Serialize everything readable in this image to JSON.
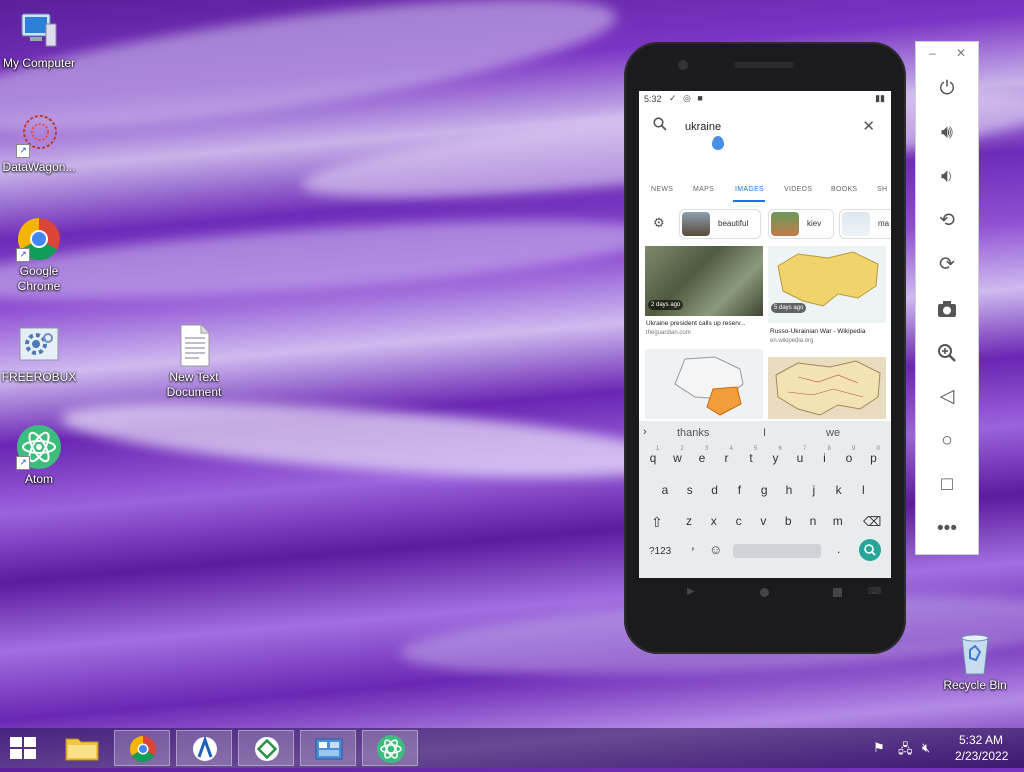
{
  "desktop": {
    "icons": [
      {
        "label": "My Computer"
      },
      {
        "label": "DataWagon..."
      },
      {
        "label": "Google Chrome"
      },
      {
        "label": "FREEROBUX"
      },
      {
        "label": "New Text Document"
      },
      {
        "label": "Atom"
      },
      {
        "label": "Recycle Bin"
      }
    ]
  },
  "phone": {
    "status": {
      "time": "5:32"
    },
    "search": {
      "query": "ukraine"
    },
    "tabs": [
      "NEWS",
      "MAPS",
      "IMAGES",
      "VIDEOS",
      "BOOKS",
      "SH"
    ],
    "active_tab": "IMAGES",
    "chips": [
      "beautiful",
      "kiev",
      "ma"
    ],
    "results": [
      {
        "badge": "2 days ago",
        "title": "Ukraine president calls up reserv...",
        "source": "theguardian.com"
      },
      {
        "badge": "5 days ago",
        "title": "Russo-Ukrainian War - Wikipedia",
        "source": "en.wikipedia.org"
      }
    ],
    "keyboard": {
      "suggestions": [
        "thanks",
        "I",
        "we"
      ],
      "row1": [
        "q",
        "w",
        "e",
        "r",
        "t",
        "y",
        "u",
        "i",
        "o",
        "p"
      ],
      "row1_hints": [
        "1",
        "2",
        "3",
        "4",
        "5",
        "6",
        "7",
        "8",
        "9",
        "0"
      ],
      "row2": [
        "a",
        "s",
        "d",
        "f",
        "g",
        "h",
        "j",
        "k",
        "l"
      ],
      "row3": [
        "z",
        "x",
        "c",
        "v",
        "b",
        "n",
        "m"
      ],
      "symbols_key": "?123",
      "period_key": ".",
      "comma_key": ","
    }
  },
  "taskbar": {
    "time": "5:32 AM",
    "date": "2/23/2022"
  },
  "colors": {
    "accent": "#1a73e8",
    "search_button": "#26a69a"
  }
}
